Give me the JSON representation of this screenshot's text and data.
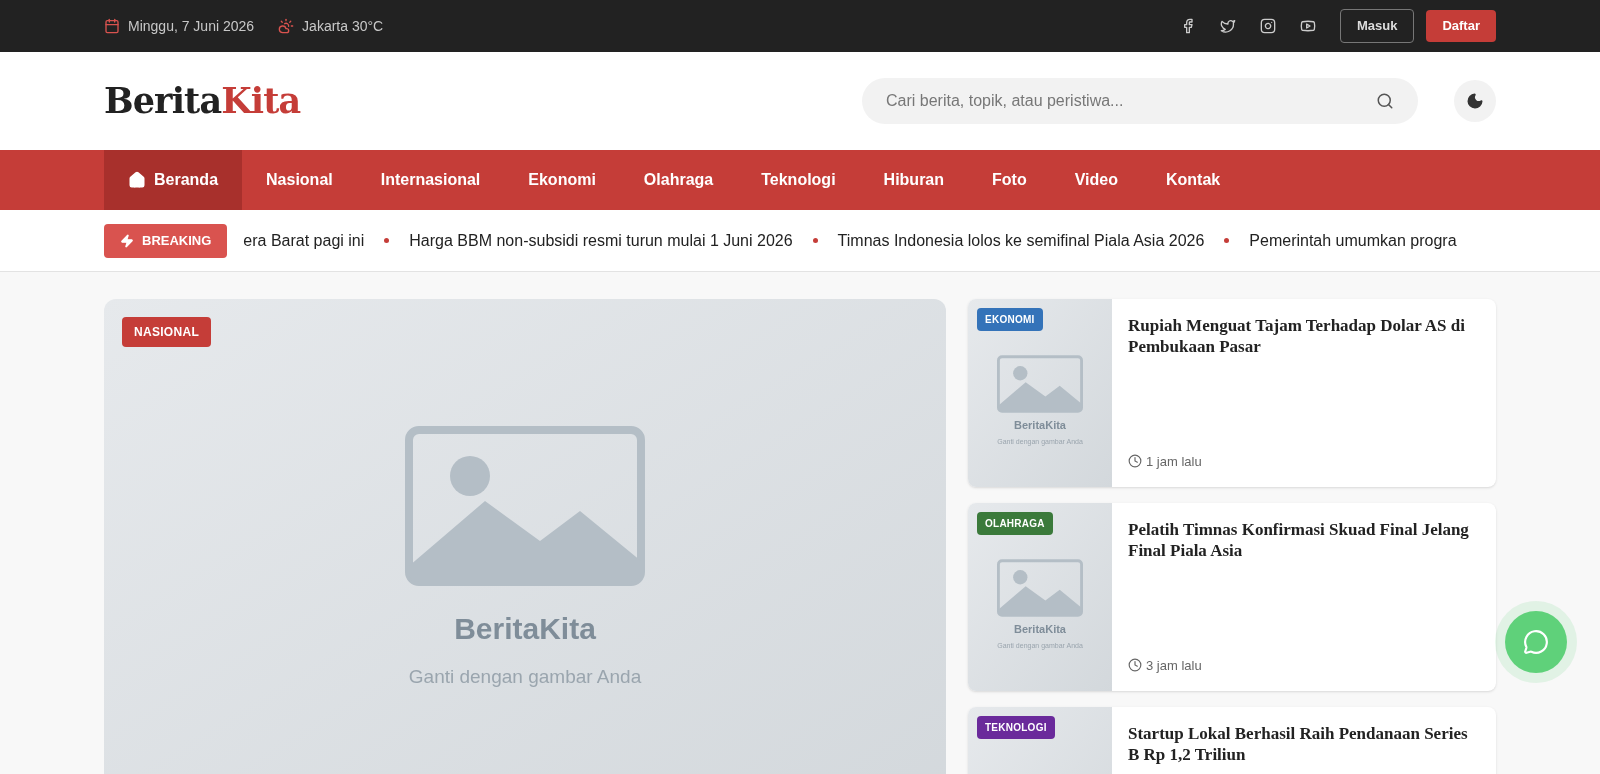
{
  "topbar": {
    "date": "Minggu, 7 Juni 2026",
    "weather": "Jakarta 30°C",
    "login": "Masuk",
    "register": "Daftar"
  },
  "header": {
    "logo_part_1": "Berita",
    "logo_part_2": "Kita",
    "search": {
      "placeholder": "Cari berita, topik, atau peristiwa..."
    }
  },
  "nav": [
    {
      "label": "Beranda",
      "selected": true
    },
    {
      "label": "Nasional",
      "selected": false
    },
    {
      "label": "Internasional",
      "selected": false
    },
    {
      "label": "Ekonomi",
      "selected": false
    },
    {
      "label": "Olahraga",
      "selected": false
    },
    {
      "label": "Teknologi",
      "selected": false
    },
    {
      "label": "Hiburan",
      "selected": false
    },
    {
      "label": "Foto",
      "selected": false
    },
    {
      "label": "Video",
      "selected": false
    },
    {
      "label": "Kontak",
      "selected": false
    }
  ],
  "breaking": {
    "label": "BREAKING",
    "items": [
      "era Barat pagi ini",
      "Harga BBM non-subsidi resmi turun mulai 1 Juni 2026",
      "Timnas Indonesia lolos ke semifinal Piala Asia 2026",
      "Pemerintah umumkan progra"
    ]
  },
  "featured": {
    "category": "NASIONAL",
    "color": "#c53d38",
    "image_title": "BeritaKita",
    "image_caption": "Ganti dengan gambar Anda"
  },
  "side_articles": [
    {
      "category": "EKONOMI",
      "color": "#3473b9",
      "title": "Rupiah Menguat Tajam Terhadap Dolar AS di Pembukaan Pasar",
      "image_title": "BeritaKita",
      "image_caption": "Ganti dengan gambar Anda",
      "time": "1 jam lalu"
    },
    {
      "category": "OLAHRAGA",
      "color": "#3b7a3b",
      "title": "Pelatih Timnas Konfirmasi Skuad Final Jelang Final Piala Asia",
      "image_title": "BeritaKita",
      "image_caption": "Ganti dengan gambar Anda",
      "time": "3 jam lalu"
    },
    {
      "category": "TEKNOLOGI",
      "color": "#6a2a9b",
      "title": "Startup Lokal Berhasil Raih Pendanaan Series B Rp 1,2 Triliun"
    }
  ]
}
